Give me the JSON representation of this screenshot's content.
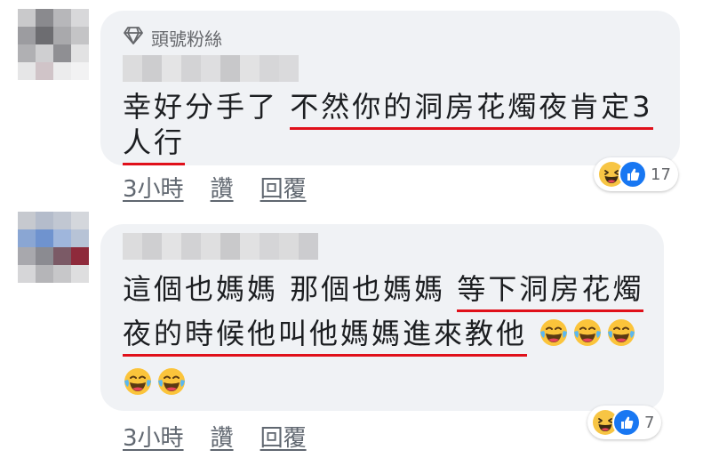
{
  "comments": [
    {
      "badge": "頭號粉絲",
      "line1_plain": "幸好分手了 ",
      "line1_ul": "不然你的洞房花燭夜肯定3",
      "line2_ul": "人行",
      "time": "3小時",
      "like": "讚",
      "reply": "回覆",
      "reaction_count": "17"
    },
    {
      "line1_plain": "這個也媽媽 那個也媽媽 ",
      "line1_ul": "等下洞房花燭",
      "line2_ul": "夜的時候他叫他媽媽進來教他",
      "time": "3小時",
      "like": "讚",
      "reply": "回覆",
      "reaction_count": "7"
    }
  ],
  "icons": {
    "badge": "diamond-icon",
    "emoji": "face-with-tears-of-joy-icon",
    "reaction_haha": "haha-reaction-icon",
    "reaction_like": "like-reaction-icon"
  },
  "colors": {
    "bubble": "#f0f2f5",
    "underline": "#e0101a",
    "like_blue": "#1877f2",
    "meta_text": "#606770"
  }
}
